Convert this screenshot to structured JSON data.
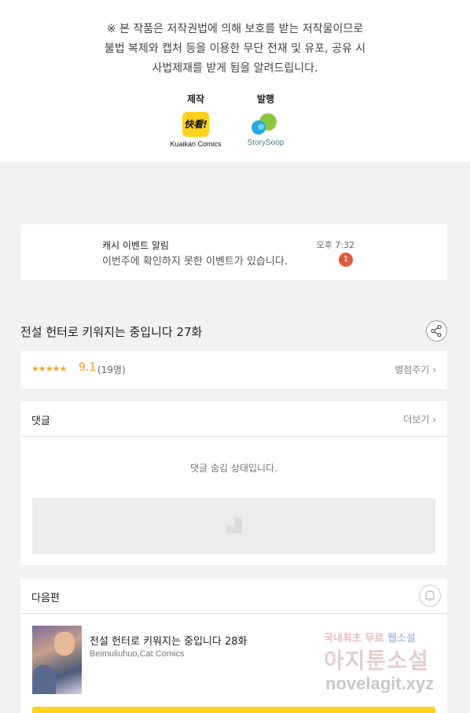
{
  "notice": {
    "line1": "※ 본 작품은 저작권법에 의해 보호를 받는 저작물이므로",
    "line2": "불법 복제와 캡처 등을 이용한 무단 전재 및 유포, 공유 시",
    "line3": "사법제재를 받게 됨을 알려드립니다.",
    "producer_role": "제작",
    "producer_logo_text": "快看!",
    "producer_name": "Kuaikan Comics",
    "publisher_role": "발행",
    "publisher_name": "StorySoop"
  },
  "notification": {
    "title": "캐시 이벤트 알림",
    "body": "이번주에 확인하지 못한 이벤트가 있습니다.",
    "time": "오후 7:32",
    "badge": "1"
  },
  "episode": {
    "title": "전설 헌터로 키워지는 중입니다 27화"
  },
  "rating": {
    "stars_display": "★★★★★",
    "score": "9.1",
    "count": "(19명)",
    "rate_link": "별점주기"
  },
  "comments": {
    "title": "댓글",
    "more_link": "더보기",
    "hidden_message": "댓글 숨김 상태입니다."
  },
  "next_episode": {
    "section_title": "다음편",
    "title": "전설 헌터로 키워지는 중입니다 28화",
    "author": "Beimuliuhuo,Cat Comics"
  },
  "watermark": {
    "line1a": "국내최초 무료",
    "line1b": "웹소설",
    "line2": "아지툰소설",
    "line3": "novelagit.xyz"
  },
  "colors": {
    "accent": "#ffd21e",
    "badge": "#e2583e",
    "score": "#e8951e"
  }
}
